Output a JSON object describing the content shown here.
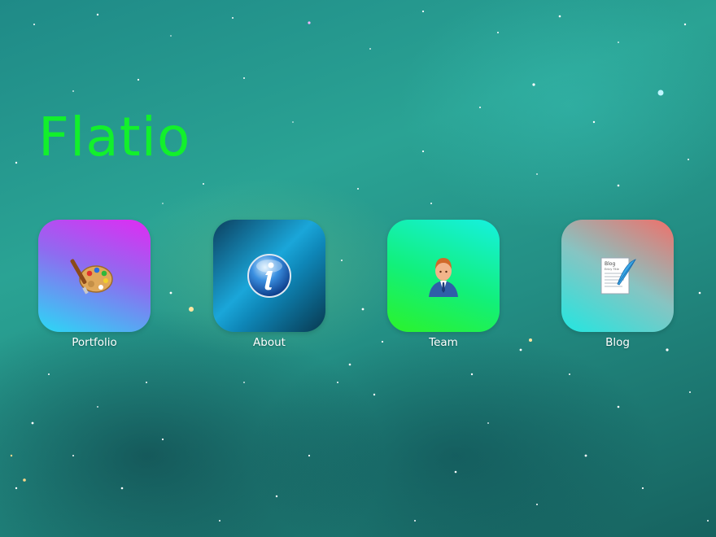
{
  "brand": {
    "title": "Flatio",
    "color": "#12f02c"
  },
  "tiles": [
    {
      "label": "Portfolio",
      "icon": "palette-icon"
    },
    {
      "label": "About",
      "icon": "info-icon"
    },
    {
      "label": "Team",
      "icon": "user-icon"
    },
    {
      "label": "Blog",
      "icon": "document-quill-icon"
    }
  ],
  "blog_icon_text": {
    "heading": "Blog",
    "subheading": "Entry Title"
  }
}
